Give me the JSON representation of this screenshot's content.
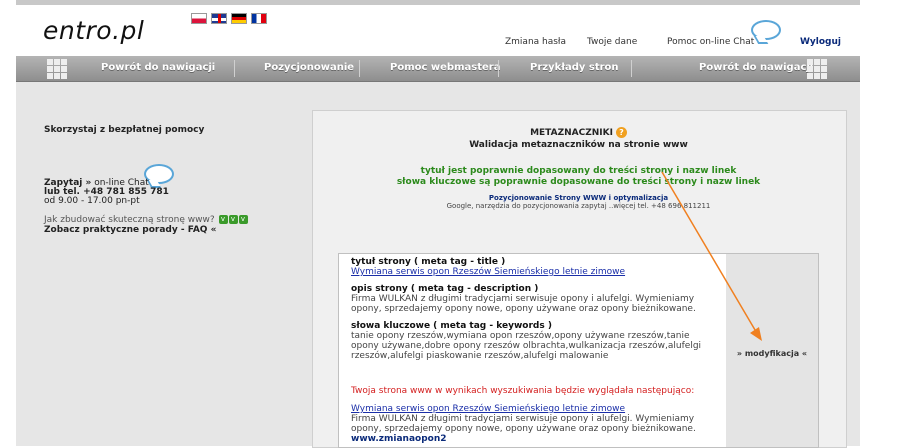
{
  "header": {
    "logo": "entro.pl",
    "flags": [
      "pl-flag",
      "uk-flag",
      "de-flag",
      "fr-flag"
    ],
    "links": {
      "change_password": "Zmiana hasła",
      "your_data": "Twoje dane",
      "chat_help": "Pomoc on-line Chat",
      "logout": "Wyloguj"
    }
  },
  "nav": {
    "back_left": "Powrót do nawigacji",
    "positioning": "Pozycjonowanie",
    "webmaster_help": "Pomoc webmastera",
    "examples": "Przykłady stron",
    "back_right": "Powrót do nawigacji"
  },
  "left": {
    "free_help": "Skorzystaj z bezpłatnej pomocy",
    "ask": "Zapytaj »",
    "online_chat": "on-line Chat",
    "phone": "lub tel. +48 781 855 781",
    "hours": "od 9.00 - 17.00 pn-pt",
    "how_to": "Jak zbudować skuteczną stronę www?",
    "faq": "Zobacz praktyczne porady - FAQ «"
  },
  "main": {
    "title": "METAZNACZNIKI",
    "subtitle": "Walidacja metaznaczników na stronie www",
    "status_line1": "tytuł jest poprawnie dopasowany do treści strony i nazw linek",
    "status_line2": "słowa kluczowe są poprawnie dopasowane do treści strony i nazw linek",
    "promo_title": "Pozycjonowanie Strony WWW i optymalizacja",
    "promo_text": "Google, narzędzia do pozycjonowania zapytaj ..więcej tel. +48 696 811211"
  },
  "meta": {
    "title_label": "tytuł strony ( meta tag - title )",
    "title_value": "Wymiana serwis opon Rzeszów Siemieńskiego letnie zimowe",
    "desc_label": "opis strony ( meta tag - description )",
    "desc_value": "Firma WULKAN z długimi tradycjami serwisuje opony i alufelgi. Wymieniamy opony, sprzedajemy opony nowe, opony używane oraz opony bieżnikowane.",
    "keywords_label": "słowa kluczowe ( meta tag - keywords )",
    "keywords_value": "tanie opony rzeszów,wymiana opon rzeszów,opony używane rzeszów,tanie opony używane,dobre opony rzeszów olbrachta,wulkanizacja rzeszów,alufelgi rzeszów,alufelgi piaskowanie rzeszów,alufelgi malowanie",
    "modify": "» modyfikacja «"
  },
  "preview": {
    "intro": "Twoja strona www w wynikach wyszukiwania będzie wyglądała następująco:",
    "link_title": "Wymiana serwis opon Rzeszów Siemieńskiego letnie zimowe",
    "snippet": "Firma WULKAN z długimi tradycjami serwisuje opony i alufelgi. Wymieniamy opony, sprzedajemy opony nowe, opony używane oraz opony bieżnikowane.",
    "url": "www.zmianaopon2"
  },
  "colors": {
    "accent_green": "#2c8a1c",
    "link_blue": "#1a2ea8",
    "warning_red": "#d42020",
    "arrow_orange": "#f08020"
  }
}
